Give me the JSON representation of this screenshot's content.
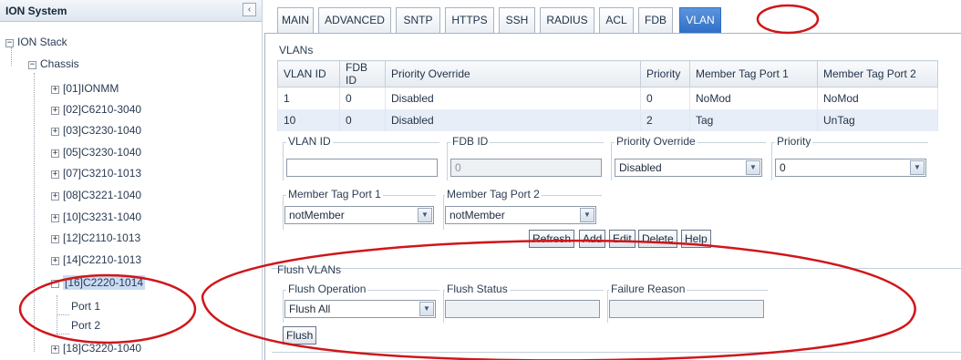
{
  "tree": {
    "title": "ION System",
    "collapse_icon": "‹",
    "items": [
      {
        "label": "ION Stack",
        "sign": "−"
      },
      {
        "label": "Chassis",
        "sign": "−"
      },
      {
        "label": "[01]IONMM",
        "sign": "+"
      },
      {
        "label": "[02]C6210-3040",
        "sign": "+"
      },
      {
        "label": "[03]C3230-1040",
        "sign": "+"
      },
      {
        "label": "[05]C3230-1040",
        "sign": "+"
      },
      {
        "label": "[07]C3210-1013",
        "sign": "+"
      },
      {
        "label": "[08]C3221-1040",
        "sign": "+"
      },
      {
        "label": "[10]C3231-1040",
        "sign": "+"
      },
      {
        "label": "[12]C2110-1013",
        "sign": "+"
      },
      {
        "label": "[14]C2210-1013",
        "sign": "+"
      },
      {
        "label": "[16]C2220-1014",
        "sign": "−"
      },
      {
        "label": "Port 1",
        "sign": ""
      },
      {
        "label": "Port 2",
        "sign": ""
      },
      {
        "label": "[18]C3220-1040",
        "sign": "+"
      }
    ]
  },
  "tabs": [
    "MAIN",
    "ADVANCED",
    "SNTP",
    "HTTPS",
    "SSH",
    "RADIUS",
    "ACL",
    "FDB",
    "VLAN"
  ],
  "active_tab": "VLAN",
  "vlans": {
    "legend": "VLANs",
    "columns": [
      "VLAN ID",
      "FDB ID",
      "Priority Override",
      "Priority",
      "Member Tag Port 1",
      "Member Tag Port 2"
    ],
    "rows": [
      [
        "1",
        "0",
        "Disabled",
        "0",
        "NoMod",
        "NoMod"
      ],
      [
        "10",
        "0",
        "Disabled",
        "2",
        "Tag",
        "UnTag"
      ]
    ]
  },
  "form": {
    "vlan_id_label": "VLAN ID",
    "vlan_id_value": "",
    "fdb_id_label": "FDB ID",
    "fdb_id_value": "0",
    "priority_override_label": "Priority Override",
    "priority_override_value": "Disabled",
    "priority_label": "Priority",
    "priority_value": "0",
    "member_tag_port1_label": "Member Tag Port 1",
    "member_tag_port1_value": "notMember",
    "member_tag_port2_label": "Member Tag Port 2",
    "member_tag_port2_value": "notMember"
  },
  "buttons": {
    "refresh": "Refresh",
    "add": "Add",
    "edit": "Edit",
    "delete": "Delete",
    "help": "Help"
  },
  "flush": {
    "legend": "Flush VLANs",
    "operation_label": "Flush Operation",
    "operation_value": "Flush All",
    "status_label": "Flush Status",
    "status_value": "",
    "failure_label": "Failure Reason",
    "failure_value": "",
    "button": "Flush"
  },
  "icons": {
    "dropdown": "chevron-down-icon",
    "expand": "plus-icon",
    "collapse": "minus-icon"
  },
  "colors": {
    "active_tab": "#2f6fc6",
    "annotation": "#d0161a",
    "selected_row": "#c9dcf4"
  }
}
